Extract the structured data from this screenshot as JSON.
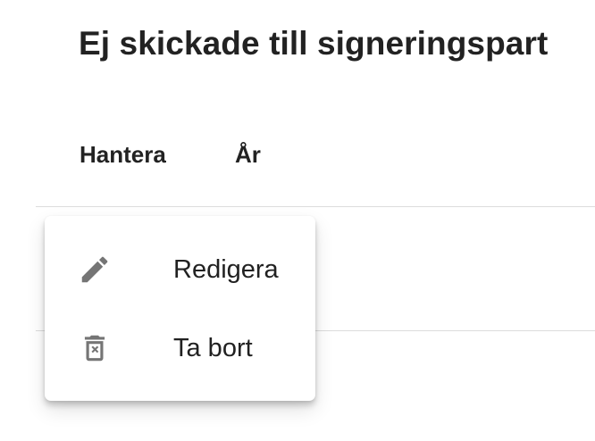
{
  "page": {
    "title": "Ej skickade till signeringspart"
  },
  "table": {
    "columns": [
      "Hantera",
      "År"
    ]
  },
  "context_menu": {
    "items": [
      {
        "label": "Redigera",
        "icon": "pencil-icon"
      },
      {
        "label": "Ta bort",
        "icon": "trash-icon"
      }
    ]
  },
  "colors": {
    "icon": "#757575",
    "text": "#212121",
    "divider": "#dcdcdc"
  }
}
